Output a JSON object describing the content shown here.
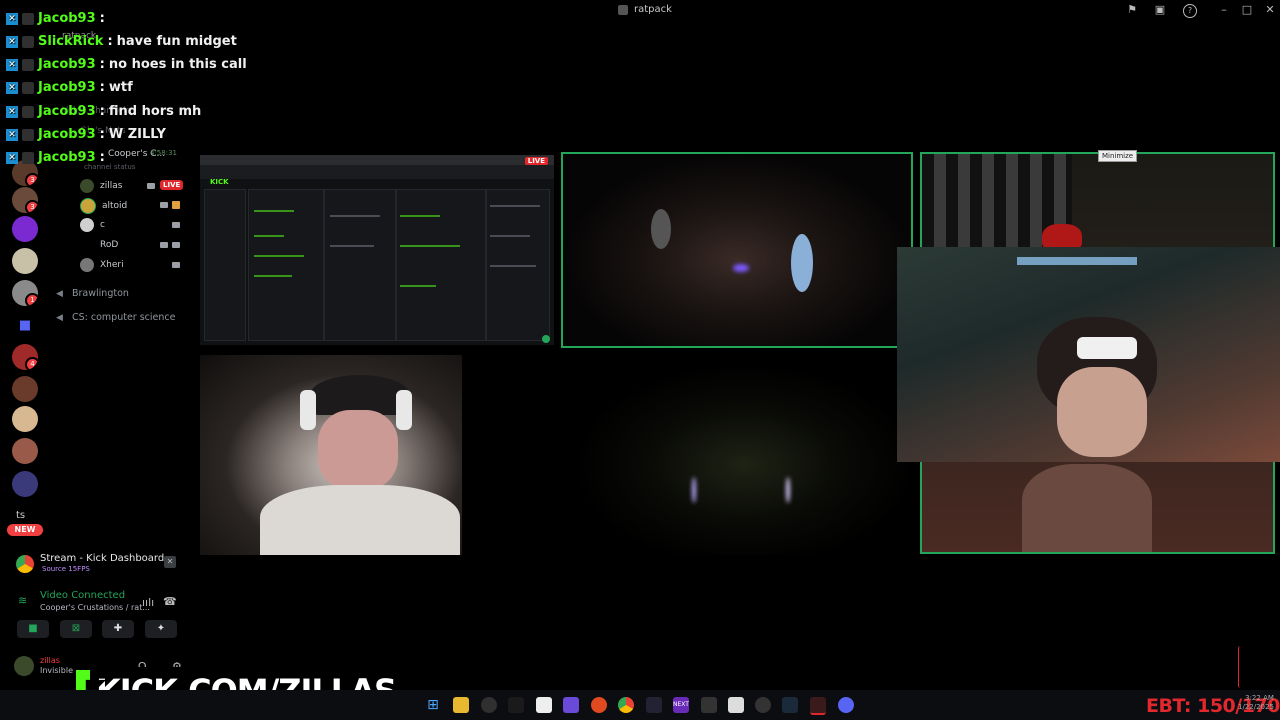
{
  "window": {
    "title": "ratpack",
    "minimize_label": "–",
    "maximize_label": "□",
    "close_label": "✕"
  },
  "header_icons": [
    "pin-icon",
    "inbox-icon",
    "help-icon"
  ],
  "server_rail": {
    "badges": [
      "3",
      "3",
      "1",
      "4"
    ],
    "ts_label": "ts",
    "new_label": "NEW"
  },
  "channels": {
    "server_name": "ratpack",
    "ghost_items": [
      "Voice Channels",
      "Glo's Nuts",
      "channel status"
    ],
    "active_channel": "Cooper's C...",
    "active_timer": "4:58:31",
    "users": [
      {
        "name": "zillas",
        "live": "LIVE"
      },
      {
        "name": "altoid"
      },
      {
        "name": "c"
      },
      {
        "name": "RoD"
      },
      {
        "name": "Xheri"
      }
    ],
    "other_channels": [
      "Brawlington",
      "CS: computer science"
    ]
  },
  "voice_panel": {
    "stream_title": "Stream - Kick Dashboard...",
    "stream_sub": "Source 15FPS",
    "status": "Video Connected",
    "location": "Cooper's Crustations / rat...",
    "username": "zillas",
    "user_status": "Invisible"
  },
  "chat": [
    {
      "user": "Jacob93",
      "message": ""
    },
    {
      "user": "SlickRick",
      "message": "have fun midget"
    },
    {
      "user": "Jacob93",
      "message": "no hoes in this call"
    },
    {
      "user": "Jacob93",
      "message": "wtf"
    },
    {
      "user": "Jacob93",
      "message": "find hors mh"
    },
    {
      "user": "Jacob93",
      "message": "W ZILLY"
    },
    {
      "user": "Jacob93",
      "message": ""
    }
  ],
  "screenshare": {
    "live_label": "LIVE",
    "logo": "KICK"
  },
  "tooltip": "Minimize",
  "watermark": {
    "logo_letter": "K",
    "url": "KICK.COM/ZILLAS"
  },
  "taskbar": {
    "ebt": "EBT: 150/170",
    "time": "3:22 AM",
    "date": "1/22/2025",
    "next_label": "NEXT"
  },
  "colors": {
    "accent_green": "#53fc18",
    "speaking_green": "#23a55a",
    "live_red": "#e0282d",
    "kick_blue": "#1b8fd1"
  }
}
